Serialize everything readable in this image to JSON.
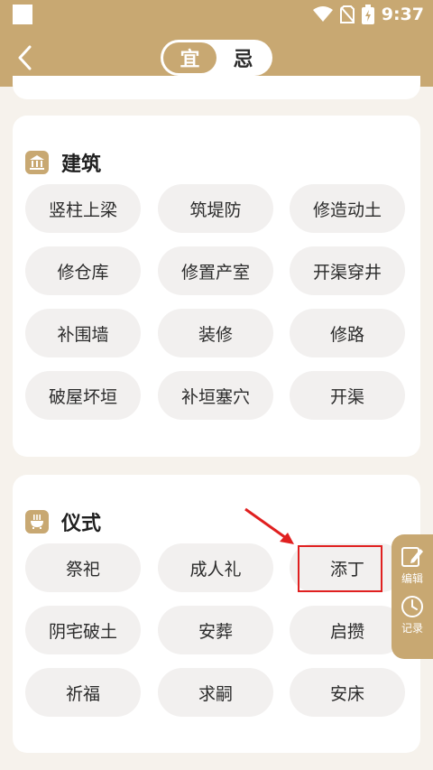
{
  "status": {
    "time": "9:37"
  },
  "header": {
    "tabs": [
      {
        "label": "宜",
        "active": true
      },
      {
        "label": "忌",
        "active": false
      }
    ]
  },
  "sections": [
    {
      "title": "建筑",
      "icon": "temple-icon",
      "items": [
        "竖柱上梁",
        "筑堤防",
        "修造动土",
        "修仓库",
        "修置产室",
        "开渠穿井",
        "补围墙",
        "装修",
        "修路",
        "破屋坏垣",
        "补垣塞穴",
        "开渠"
      ]
    },
    {
      "title": "仪式",
      "icon": "censer-icon",
      "items": [
        "祭祀",
        "成人礼",
        "添丁",
        "阴宅破土",
        "安葬",
        "启攒",
        "祈福",
        "求嗣",
        "安床"
      ]
    }
  ],
  "side_panel": {
    "edit_label": "编辑",
    "record_label": "记录"
  },
  "colors": {
    "accent": "#c8a872",
    "pill_bg": "#f2f0ef",
    "annotation": "#e02020"
  }
}
